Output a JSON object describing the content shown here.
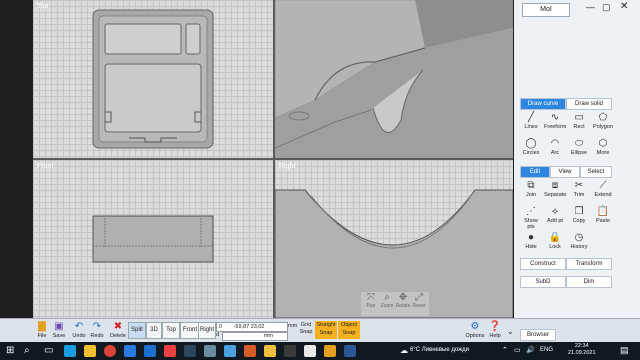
{
  "viewports": {
    "top": "Top",
    "view3d": "3D",
    "front": "Front",
    "right": "Right"
  },
  "nav_controls": [
    {
      "label": "Pan",
      "icon": "pan-icon"
    },
    {
      "label": "Zoom",
      "icon": "zoom-icon"
    },
    {
      "label": "Rotate",
      "icon": "rotate-icon"
    },
    {
      "label": "Reset",
      "icon": "reset-icon"
    }
  ],
  "sidebar": {
    "logo": "MoI",
    "draw_tabs": [
      "Draw curve",
      "Draw solid"
    ],
    "curve_tools": [
      {
        "label": "Lines",
        "icon": "lines-icon",
        "glyph": "╱"
      },
      {
        "label": "Freeform",
        "icon": "freeform-icon",
        "glyph": "∿"
      },
      {
        "label": "Rect",
        "icon": "rect-icon",
        "glyph": "▭"
      },
      {
        "label": "Polygon",
        "icon": "polygon-icon",
        "glyph": "⬠"
      },
      {
        "label": "Circles",
        "icon": "circles-icon",
        "glyph": "◯"
      },
      {
        "label": "Arc",
        "icon": "arc-icon",
        "glyph": "◠"
      },
      {
        "label": "Ellipse",
        "icon": "ellipse-icon",
        "glyph": "⬭"
      },
      {
        "label": "More",
        "icon": "more-icon",
        "glyph": "⬡"
      }
    ],
    "edit_tabs": [
      "Edit",
      "View",
      "Select"
    ],
    "edit_tools": [
      {
        "label": "Join",
        "icon": "join-icon",
        "glyph": "⧉"
      },
      {
        "label": "Separate",
        "icon": "separate-icon",
        "glyph": "⧈"
      },
      {
        "label": "Trim",
        "icon": "trim-icon",
        "glyph": "✂"
      },
      {
        "label": "Extend",
        "icon": "extend-icon",
        "glyph": "⟋"
      },
      {
        "label": "Show pts",
        "icon": "show-points-icon",
        "glyph": "⋰"
      },
      {
        "label": "Add pt",
        "icon": "add-point-icon",
        "glyph": "⟡"
      },
      {
        "label": "Copy",
        "icon": "copy-icon",
        "glyph": "❐"
      },
      {
        "label": "Paste",
        "icon": "paste-icon",
        "glyph": "📋"
      },
      {
        "label": "Hide",
        "icon": "hide-icon",
        "glyph": "●"
      },
      {
        "label": "Lock",
        "icon": "lock-icon",
        "glyph": "🔒"
      },
      {
        "label": "History",
        "icon": "history-icon",
        "glyph": "◷"
      }
    ],
    "construct_buttons": [
      "Construct",
      "Transform"
    ],
    "sub_buttons": [
      "SubD",
      "Dim"
    ],
    "browser_label": "Browser"
  },
  "toolbar": {
    "file": "File",
    "save": "Save",
    "undo": "Undo",
    "redo": "Redo",
    "delete": "Delete",
    "views": [
      "Split",
      "3D",
      "Top",
      "Front",
      "Right"
    ],
    "coord_x": "0",
    "coord_value": "-59,87  23,02",
    "unit": "mm",
    "d_label": "d",
    "d_unit": "mm",
    "grid_snap": "Grid Snap",
    "straight_snap": "Straight Snap",
    "object_snap": "Object Snap",
    "options": "Options",
    "help": "Help"
  },
  "taskbar": {
    "weather": "6°C  Ливневые дожди",
    "lang": "ENG",
    "time": "22:34",
    "date": "21.09.2021"
  }
}
